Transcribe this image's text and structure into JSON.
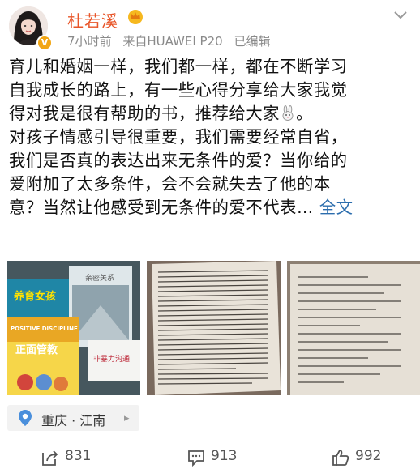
{
  "post": {
    "user": {
      "name": "杜若溪",
      "verified_badge": "V"
    },
    "meta": {
      "time": "7小时前",
      "source": "来自HUAWEI P20",
      "edited": "已编辑"
    },
    "text_lines": [
      "育儿和婚姻一样，我们都一样，都在不断学习",
      "自我成长的路上，有一些心得分享给大家我觉",
      "得对我是很有帮助的书，推荐给大家",
      "对孩子情感引导很重要，我们需要经常自省，",
      "我们是否真的表达出来无条件的爱？当你给的",
      "爱附加了太多条件，会不会就失去了他的本",
      "意？当然让他感受到无条件的爱不代表…"
    ],
    "line3_tail": "。",
    "full_text_link": "全文",
    "images": [
      {
        "book_titles": [
          "养育女孩",
          "POSITIVE DISCIPLINE",
          "正面管教",
          "亲密关系",
          "非暴力沟通"
        ]
      },
      {
        "caption": ""
      },
      {
        "caption": ""
      }
    ],
    "location": {
      "label": "重庆 · 江南",
      "arrow": "▸"
    }
  },
  "actions": {
    "repost": {
      "count": "831",
      "icon": "repost-icon"
    },
    "comment": {
      "count": "913",
      "icon": "comment-icon"
    },
    "like": {
      "count": "992",
      "icon": "thumbs-up-icon"
    }
  },
  "colors": {
    "username": "#e8562a",
    "link": "#2b6dad",
    "meta": "#8a8a8a"
  }
}
